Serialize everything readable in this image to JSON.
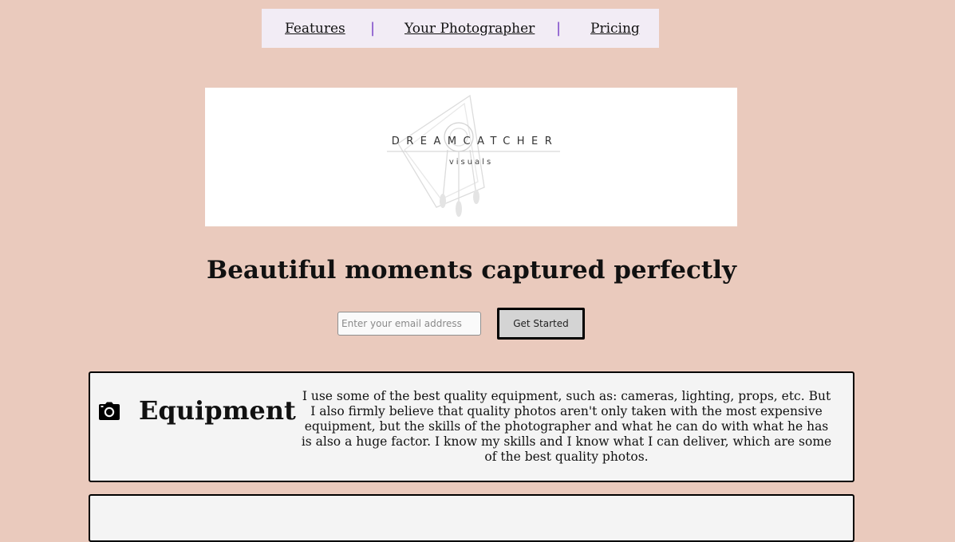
{
  "nav": {
    "items": [
      {
        "label": "Features"
      },
      {
        "label": "Your Photographer"
      },
      {
        "label": "Pricing"
      }
    ],
    "separator": "|",
    "separator_color": "#7a44c8"
  },
  "logo": {
    "main_text": "DREAMCATCHER",
    "sub_text": "visuals"
  },
  "hero": {
    "headline": "Beautiful moments captured perfectly"
  },
  "signup": {
    "email_placeholder": "Enter your email address",
    "email_value": "",
    "button_label": "Get Started"
  },
  "features": [
    {
      "icon": "camera-icon",
      "title": "Equipment",
      "text": "I use some of the best quality equipment, such as: cameras, lighting, props, etc. But I also firmly believe that quality photos aren't only taken with the most expensive equipment, but the skills of the photographer and what he can do with what he has is also a huge factor. I know my skills and I know what I can deliver, which are some of the best quality photos."
    }
  ],
  "colors": {
    "page_background": "#eacabd",
    "nav_background": "#f2ecf5",
    "feature_background": "#f4f4f4",
    "button_background": "#d4d4d4"
  }
}
